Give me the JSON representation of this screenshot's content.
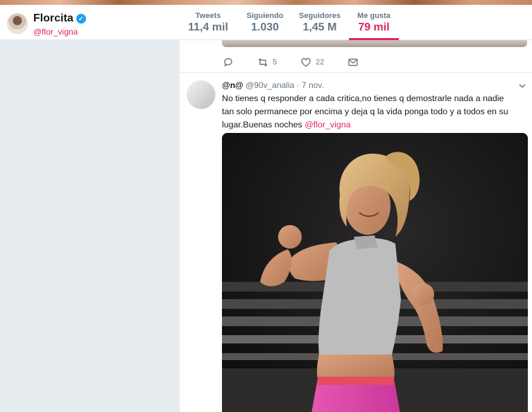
{
  "profile": {
    "name": "Florcita",
    "handle": "@flor_vigna"
  },
  "stats": [
    {
      "label": "Tweets",
      "value": "11,4 mil"
    },
    {
      "label": "Siguiendo",
      "value": "1.030"
    },
    {
      "label": "Seguidores",
      "value": "1,45 M"
    },
    {
      "label": "Me gusta",
      "value": "79 mil"
    }
  ],
  "previous_tweet": {
    "retweets": "5",
    "likes": "22"
  },
  "tweet": {
    "name": "@n@",
    "handle": "@90v_analia",
    "separator": "·",
    "date": "7 nov.",
    "text": "No tienes q responder a cada critica,no tienes q demostrarle nada a nadie tan solo permanece por encima y deja q la vida ponga todo y a todos en su lugar.Buenas noches ",
    "mention": "@flor_vigna"
  },
  "colors": {
    "accent": "#e0245e",
    "verified": "#1da1f2"
  },
  "icons": [
    "verified-badge-icon",
    "reply-icon",
    "retweet-icon",
    "like-icon",
    "message-icon",
    "chevron-down-icon"
  ]
}
